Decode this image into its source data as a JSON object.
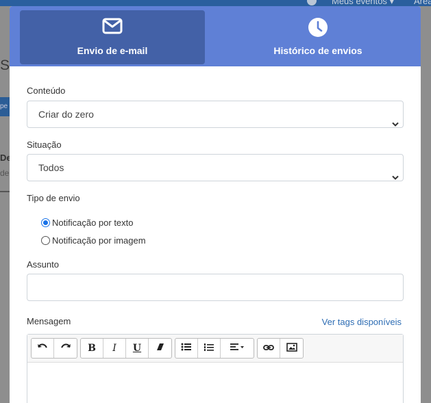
{
  "background": {
    "events_menu": "Meus eventos ▾",
    "area_menu": "Área",
    "left_letter": "S",
    "left_button": "pe",
    "left_heading": "De",
    "left_sub": "de"
  },
  "tabs": [
    {
      "label": "Envio de e-mail",
      "icon": "envelope-icon",
      "active": true
    },
    {
      "label": "Histórico de envios",
      "icon": "clock-icon",
      "active": false
    }
  ],
  "form": {
    "content_label": "Conteúdo",
    "content_value": "Criar do zero",
    "situation_label": "Situação",
    "situation_value": "Todos",
    "send_type_label": "Tipo de envio",
    "send_type_options": [
      {
        "label": "Notificação por texto",
        "checked": true
      },
      {
        "label": "Notificação por imagem",
        "checked": false
      }
    ],
    "subject_label": "Assunto",
    "subject_value": "",
    "message_label": "Mensagem",
    "tags_link": "Ver tags disponíveis"
  },
  "toolbar": {
    "bold": "B",
    "italic": "I",
    "underline": "U"
  },
  "colors": {
    "tab_bar": "#5f80d6",
    "tab_active": "#4361a7",
    "link": "#2e6db4",
    "radio_checked": "#1a73e8"
  }
}
